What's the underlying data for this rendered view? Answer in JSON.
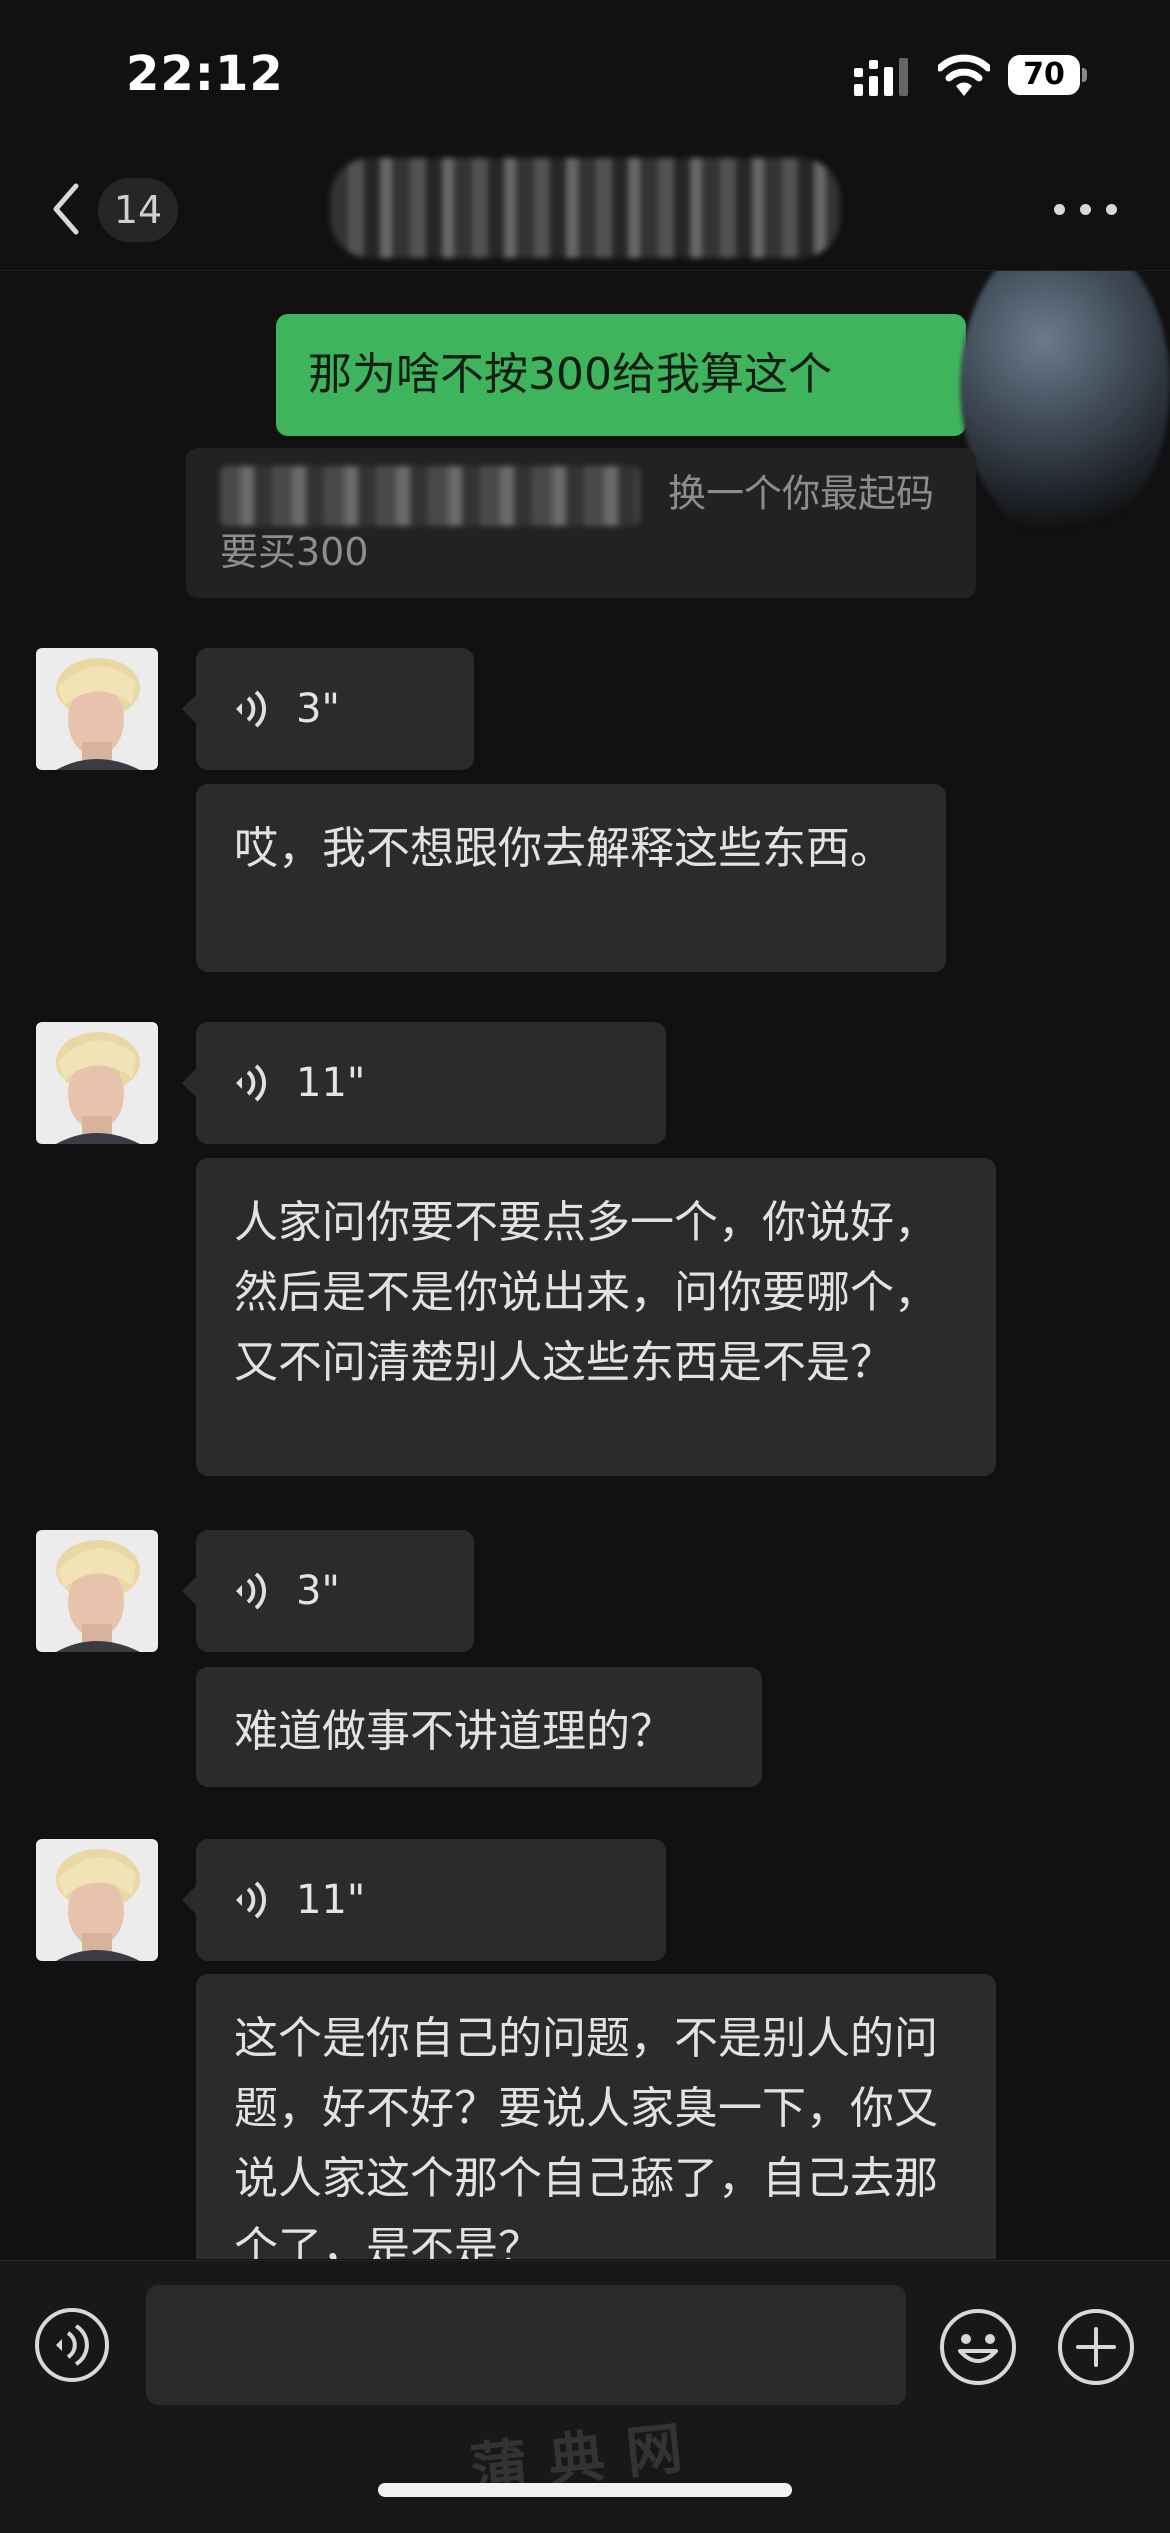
{
  "status_bar": {
    "time": "22:12",
    "battery": "70"
  },
  "nav": {
    "unread_count": "14"
  },
  "messages": {
    "sent": "那为啥不按300给我算这个",
    "quote_text": "换一个你最起码要买300",
    "voice1_duration": "3\"",
    "text1": "哎，我不想跟你去解释这些东西。",
    "voice2_duration": "11\"",
    "text2": "人家问你要不要点多一个，你说好，然后是不是你说出来，问你要哪个，又不问清楚别人这些东西是不是？",
    "voice3_duration": "3\"",
    "text3": "难道做事不讲道理的？",
    "voice4_duration": "11\"",
    "text4": "这个是你自己的问题，不是别人的问题，好不好？要说人家臭一下，你又说人家这个那个自己舔了，自己去那个了，是不是？"
  },
  "input": {
    "placeholder": ""
  },
  "watermark": "蒲典网",
  "colors": {
    "sent_bubble": "#3eb55d",
    "received_bubble": "#2b2b2b",
    "background": "#111111"
  }
}
